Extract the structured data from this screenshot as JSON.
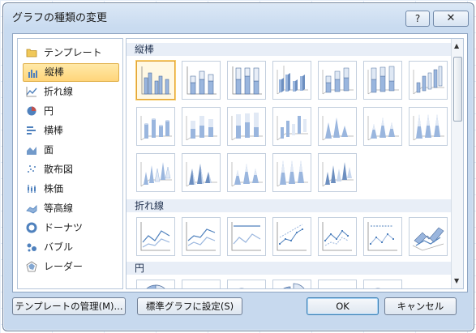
{
  "dialog": {
    "title": "グラフの種類の変更",
    "help_label": "?",
    "close_label": "✕"
  },
  "categories": [
    {
      "label": "テンプレート",
      "icon": "folder-icon"
    },
    {
      "label": "縦棒",
      "icon": "column-chart-icon",
      "selected": true
    },
    {
      "label": "折れ線",
      "icon": "line-chart-icon"
    },
    {
      "label": "円",
      "icon": "pie-chart-icon"
    },
    {
      "label": "横棒",
      "icon": "bar-chart-icon"
    },
    {
      "label": "面",
      "icon": "area-chart-icon"
    },
    {
      "label": "散布図",
      "icon": "scatter-chart-icon"
    },
    {
      "label": "株価",
      "icon": "stock-chart-icon"
    },
    {
      "label": "等高線",
      "icon": "surface-chart-icon"
    },
    {
      "label": "ドーナツ",
      "icon": "doughnut-chart-icon"
    },
    {
      "label": "バブル",
      "icon": "bubble-chart-icon"
    },
    {
      "label": "レーダー",
      "icon": "radar-chart-icon"
    }
  ],
  "sections": {
    "column": {
      "label": "縦棒"
    },
    "line": {
      "label": "折れ線"
    },
    "pie": {
      "label": "円"
    }
  },
  "buttons": {
    "manage_templates": "テンプレートの管理(M)...",
    "set_default": "標準グラフに設定(S)",
    "ok": "OK",
    "cancel": "キャンセル"
  },
  "colors": {
    "accent": "#4f81bd",
    "selection": "#ffd57a"
  }
}
